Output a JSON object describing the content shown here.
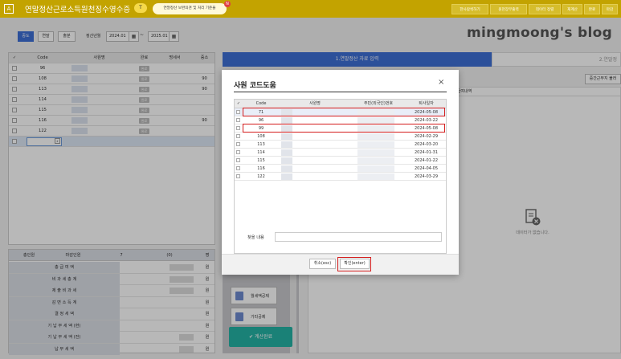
{
  "topbar": {
    "app_icon": "A",
    "title": "연말정산근로소득원천징수영수증",
    "badge": "T",
    "notice": "연말정산 보완의견 및 처리 기준을",
    "notice_count": "N",
    "buttons": [
      "한사람씩하기",
      "원천장부출력",
      "데이터 정렬",
      "재계산",
      "완료",
      "마감"
    ]
  },
  "watermark": "mingmoong's blog",
  "filter": {
    "segments": [
      "중도",
      "연말",
      "출분"
    ],
    "period_label": "정산년월",
    "date_from": "2024.01",
    "date_to": "2025.01",
    "tilde": "~"
  },
  "left_table": {
    "headers": [
      "Code",
      "사원명",
      "완료",
      "명세서",
      "중소"
    ],
    "rows": [
      {
        "code": "96",
        "done": "완료",
        "sme": ""
      },
      {
        "code": "108",
        "done": "완료",
        "sme": "90"
      },
      {
        "code": "113",
        "done": "완료",
        "sme": "90"
      },
      {
        "code": "114",
        "done": "완료",
        "sme": ""
      },
      {
        "code": "115",
        "done": "완료",
        "sme": ""
      },
      {
        "code": "116",
        "done": "완료",
        "sme": "90"
      },
      {
        "code": "122",
        "done": "완료",
        "sme": ""
      }
    ]
  },
  "summary": {
    "head": {
      "c1": "총인원",
      "c2": "마감인원",
      "c3": "7",
      "c4": "(0)",
      "c5": "명"
    },
    "rows": [
      {
        "label": "총 급 여 액",
        "unit": "원"
      },
      {
        "label": "비 과 세 총 계",
        "unit": "원"
      },
      {
        "label": "제 출 비 과 세",
        "unit": "원"
      },
      {
        "label": "감 면 소 득 계",
        "unit": "원"
      },
      {
        "label": "결 정 세 액",
        "unit": "원"
      },
      {
        "label": "기 납 부 세 액 (현)",
        "unit": "원"
      },
      {
        "label": "기 납 부 세 액 (전)",
        "unit": "원"
      },
      {
        "label": "납 부 세 액",
        "unit": "원"
      }
    ]
  },
  "right_panel": {
    "tab1": "1.연말정산 자료 입력",
    "tab2": "2.연말정",
    "btn": "중간근무지 불러",
    "col_header": "급여내역",
    "no_data": "데이터가 없습니다."
  },
  "side": {
    "btn1": "월세액공제",
    "btn2": "기타공제",
    "done": "계산완료"
  },
  "modal": {
    "title": "사원 코드도움",
    "close": "×",
    "headers": [
      "Code",
      "사원명",
      "주민(외국인)번호",
      "퇴사일자"
    ],
    "rows": [
      {
        "code": "71",
        "date": "2024-05-08"
      },
      {
        "code": "96",
        "date": "2024-03-22"
      },
      {
        "code": "99",
        "date": "2024-05-08"
      },
      {
        "code": "108",
        "date": "2024-02-29"
      },
      {
        "code": "113",
        "date": "2024-03-20"
      },
      {
        "code": "114",
        "date": "2024-01-31"
      },
      {
        "code": "115",
        "date": "2024-01-22"
      },
      {
        "code": "116",
        "date": "2024-04-05"
      },
      {
        "code": "122",
        "date": "2024-03-29"
      }
    ],
    "search_label": "찾을 내용",
    "cancel": "취소(esc)",
    "ok": "확인(enter)"
  },
  "colors": {
    "topbar": "#c3a300",
    "tab_active": "#3e6fd6",
    "calc_done": "#25b3a6",
    "highlight": "#d41c1c"
  }
}
